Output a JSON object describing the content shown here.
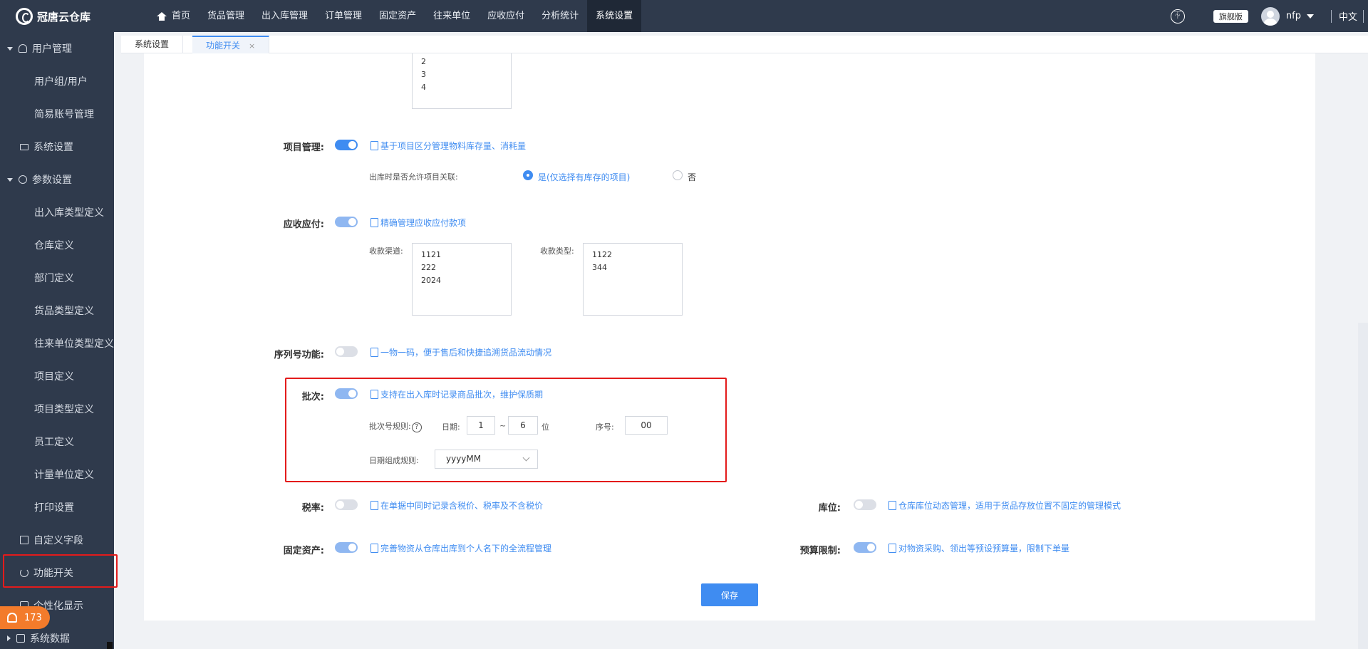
{
  "app": {
    "name": "冠唐云仓库"
  },
  "nav": {
    "items": [
      "首页",
      "货品管理",
      "出入库管理",
      "订单管理",
      "固定资产",
      "往来单位",
      "应收应付",
      "分析统计",
      "系统设置"
    ],
    "active": "系统设置"
  },
  "header": {
    "edition": "旗舰版",
    "username": "nfp",
    "language": "中文"
  },
  "sidebar": {
    "user_mgmt": "用户管理",
    "user_group": "用户组/用户",
    "simple_account": "简易账号管理",
    "system_settings": "系统设置",
    "param_settings": "参数设置",
    "io_type": "出入库类型定义",
    "warehouse": "仓库定义",
    "department": "部门定义",
    "goods_type": "货品类型定义",
    "partner_type": "往来单位类型定义",
    "project": "项目定义",
    "project_type": "项目类型定义",
    "employee": "员工定义",
    "unit": "计量单位定义",
    "print": "打印设置",
    "custom_fields": "自定义字段",
    "feature_switch": "功能开关",
    "personalize": "个性化显示",
    "system_data": "系统数据",
    "badge_count": "173"
  },
  "tabs": {
    "tab1": "系统设置",
    "tab2": "功能开关",
    "close": "×"
  },
  "top_list": [
    "2",
    "3",
    "4"
  ],
  "project": {
    "label": "项目管理:",
    "desc": "基于项目区分管理物料库存量、消耗量",
    "allow_label": "出库时是否允许项目关联:",
    "yes": "是(仅选择有库存的项目)",
    "no": "否"
  },
  "ar_ap": {
    "label": "应收应付:",
    "desc": "精确管理应收应付款项",
    "channel_label": "收款渠道:",
    "channels": [
      "1121",
      "222",
      "2024"
    ],
    "type_label": "收款类型:",
    "types": [
      "1122",
      "344"
    ]
  },
  "serial": {
    "label": "序列号功能:",
    "desc": "一物一码，便于售后和快捷追溯货品流动情况"
  },
  "batch": {
    "label": "批次:",
    "desc": "支持在出入库时记录商品批次，维护保质期",
    "rule_label": "批次号规则:",
    "help": "?",
    "date_label": "日期:",
    "date_from": "1",
    "tilde": "~",
    "date_to": "6",
    "unit": "位",
    "seq_label": "序号:",
    "seq_value": "00",
    "date_rule_label": "日期组成规则:",
    "date_rule_value": "yyyyMM"
  },
  "tax": {
    "label": "税率:",
    "desc": "在单据中同时记录含税价、税率及不含税价"
  },
  "location": {
    "label": "库位:",
    "desc": "仓库库位动态管理，适用于货品存放位置不固定的管理模式"
  },
  "fixed_asset": {
    "label": "固定资产:",
    "desc": "完善物资从仓库出库到个人名下的全流程管理"
  },
  "budget": {
    "label": "预算限制:",
    "desc": "对物资采购、领出等预设预算量，限制下单量"
  },
  "save_label": "保存",
  "colors": {
    "accent": "#3f8cf1",
    "sidebar_bg": "#2f3a4c",
    "highlight": "#e31b1b",
    "badge": "#f37b2b"
  }
}
